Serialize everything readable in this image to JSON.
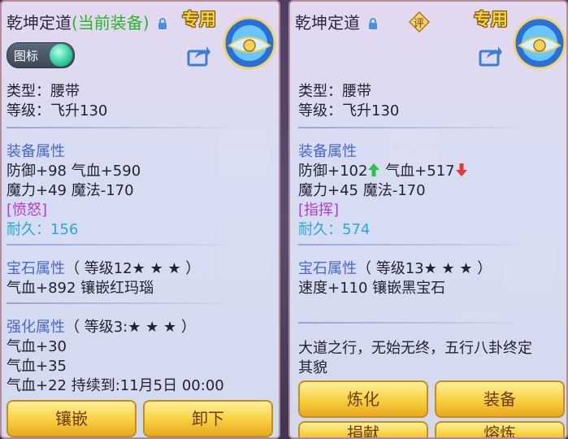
{
  "left": {
    "title": "乾坤定道",
    "equipped_tag": "(当前装备)",
    "special_label": "专用",
    "toggle_label": "图标",
    "type_line": "类型：腰带",
    "level_line": "等级：飞升130",
    "equip_attr_header": "装备属性",
    "attr_line1": "防御+98 气血+590",
    "attr_line2": "魔力+49 魔法-170",
    "special_skill": "[愤怒]",
    "durability_label": "耐久：",
    "durability_value": "156",
    "gem_header": "宝石属性",
    "gem_level": "（ 等级12★ ★ ★ ）",
    "gem_line": "气血+892 镶嵌红玛瑙",
    "enhance_header": "强化属性",
    "enhance_level": "（ 等级3:★ ★ ★ ）",
    "enhance_line1": "气血+30",
    "enhance_line2": "气血+35",
    "enhance_line3": "气血+22    持续到:11月5日 00:00",
    "btn_inlay": "镶嵌",
    "btn_unequip": "卸下"
  },
  "right": {
    "title": "乾坤定道",
    "rate_label": "评",
    "special_label": "专用",
    "type_line": "类型：腰带",
    "level_line": "等级：飞升130",
    "equip_attr_header": "装备属性",
    "attr_def": "防御+102",
    "attr_hp": "气血+517",
    "attr_line2": "魔力+45 魔法-170",
    "special_skill": "[指挥]",
    "durability_label": "耐久：",
    "durability_value": "574",
    "gem_header": "宝石属性",
    "gem_level": "（ 等级13★ ★ ★ ）",
    "gem_line": "速度+110 镶嵌黑宝石",
    "desc_line1": "大道之行，无始无终，五行八卦终定",
    "desc_line2": "其貌",
    "btn_refine": "炼化",
    "btn_equip": "装备",
    "btn_donate": "捐献",
    "btn_smelt": "熔炼"
  },
  "colors": {
    "up_arrow": "#2fbf4f",
    "down_arrow": "#e53a3a",
    "section": "#4a68c9",
    "special_skill": "#b23ad0",
    "durability": "#2aa8d8"
  }
}
